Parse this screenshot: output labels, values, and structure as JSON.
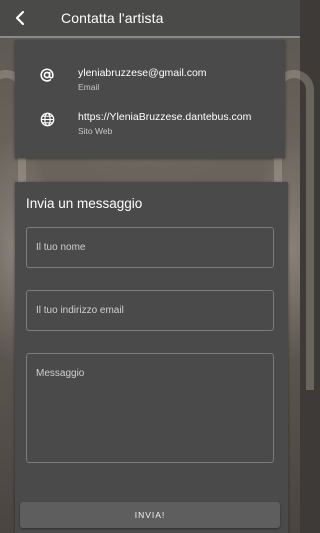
{
  "header": {
    "title": "Contatta l'artista",
    "back_icon": "chevron-left-icon"
  },
  "contacts": {
    "email": {
      "icon": "at-icon",
      "value": "yleniabruzzese@gmail.com",
      "label": "Email"
    },
    "website": {
      "icon": "globe-icon",
      "value": "https://YleniaBruzzese.dantebus.com",
      "label": "Sito Web"
    }
  },
  "form": {
    "heading": "Invia un messaggio",
    "name_placeholder": "Il tuo nome",
    "email_placeholder": "Il tuo indirizzo email",
    "message_placeholder": "Messaggio",
    "submit_label": "INVIA!"
  }
}
